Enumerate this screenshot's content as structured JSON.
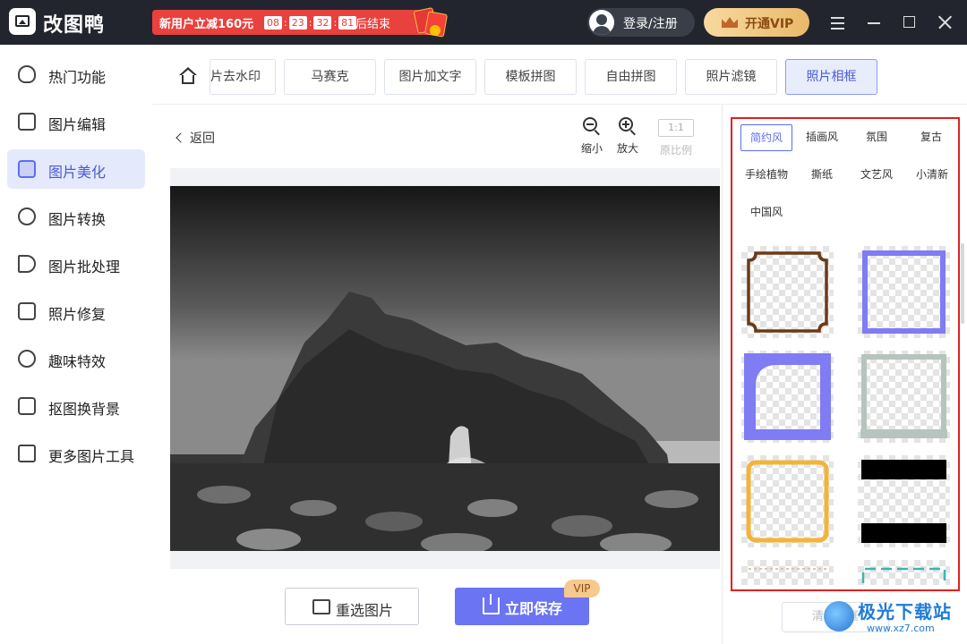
{
  "app": {
    "title": "改图鸭"
  },
  "promo": {
    "text": "新用户立减160元",
    "timer": [
      "08",
      "23",
      "32",
      "81"
    ],
    "suffix": "后结束"
  },
  "header": {
    "login_label": "登录/注册",
    "vip_label": "开通VIP"
  },
  "sidebar": {
    "items": [
      {
        "label": "热门功能",
        "icon": "fire-icon"
      },
      {
        "label": "图片编辑",
        "icon": "image-edit-icon"
      },
      {
        "label": "图片美化",
        "icon": "image-beautify-icon",
        "active": true
      },
      {
        "label": "图片转换",
        "icon": "convert-icon"
      },
      {
        "label": "图片批处理",
        "icon": "batch-icon"
      },
      {
        "label": "照片修复",
        "icon": "repair-icon"
      },
      {
        "label": "趣味特效",
        "icon": "magic-wand-icon"
      },
      {
        "label": "抠图换背景",
        "icon": "cutout-icon"
      },
      {
        "label": "更多图片工具",
        "icon": "toolbox-icon"
      }
    ]
  },
  "tabs": {
    "items": [
      {
        "label": "片去水印"
      },
      {
        "label": "马赛克"
      },
      {
        "label": "图片加文字"
      },
      {
        "label": "模板拼图"
      },
      {
        "label": "自由拼图"
      },
      {
        "label": "照片滤镜"
      },
      {
        "label": "照片相框",
        "active": true
      }
    ]
  },
  "editor": {
    "back_label": "返回",
    "zoom_out_label": "缩小",
    "zoom_in_label": "放大",
    "ratio_box": "1:1",
    "ratio_label": "原比例",
    "reselect_label": "重选图片",
    "save_label": "立即保存",
    "vip_tag": "VIP"
  },
  "panel": {
    "categories": [
      "简约风",
      "插画风",
      "氛围",
      "复古",
      "手绘植物",
      "撕纸",
      "文艺风",
      "小清新",
      "中国风"
    ],
    "active_category": "简约风",
    "clear_label": "清除相框"
  },
  "watermark": {
    "line1": "极光下载站",
    "line2": "www.xz7.com"
  },
  "colors": {
    "accent": "#6b74f3",
    "highlight_border": "#e02020",
    "titlebar": "#22252d",
    "promo": "#e8413e"
  }
}
